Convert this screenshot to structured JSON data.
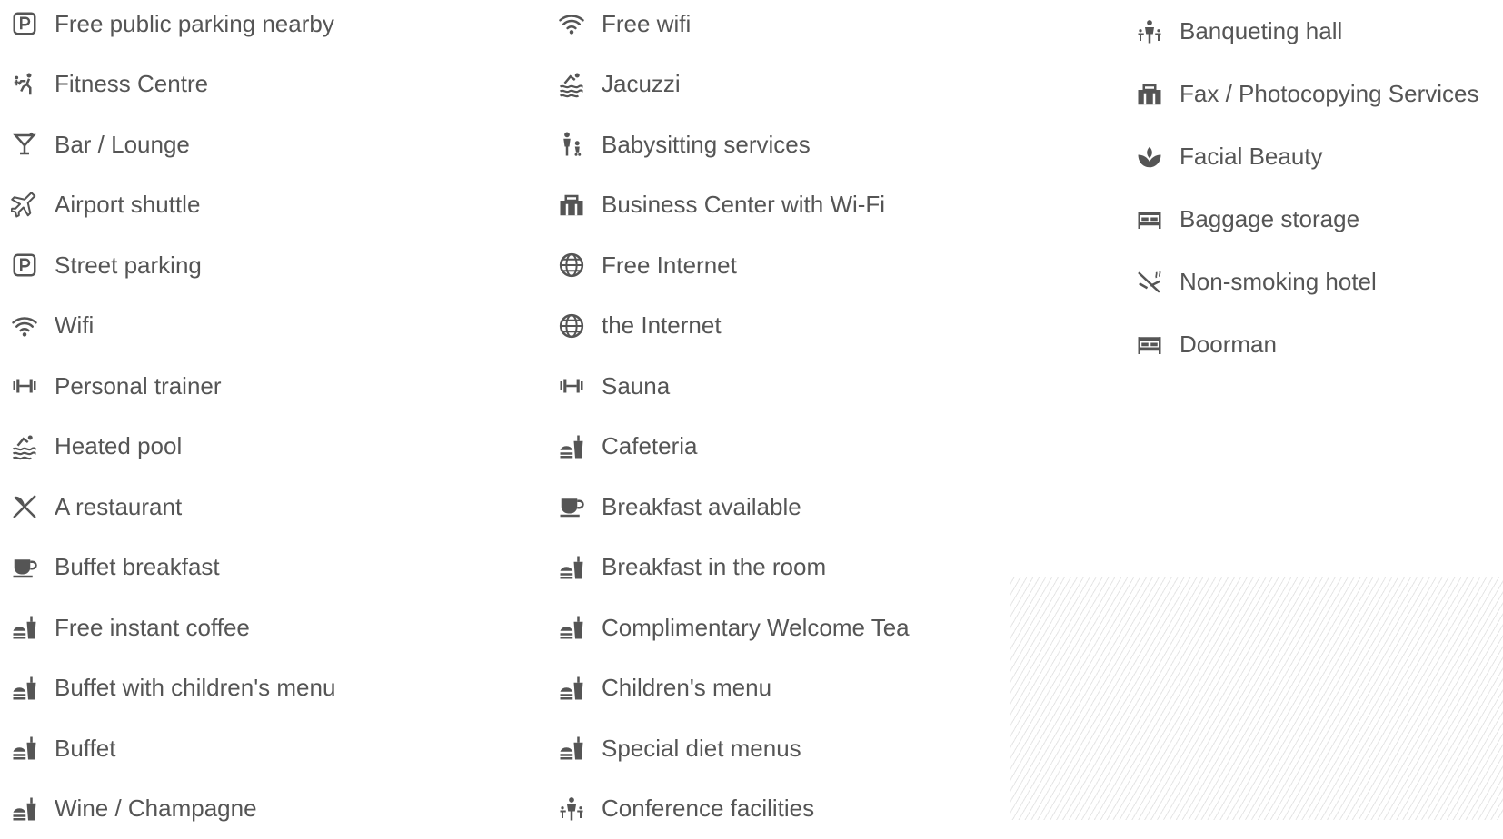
{
  "columns": [
    [
      {
        "label": "Free public parking nearby",
        "icon": "parking-icon"
      },
      {
        "label": "Fitness Centre",
        "icon": "fitness-icon"
      },
      {
        "label": "Bar / Lounge",
        "icon": "cocktail-icon"
      },
      {
        "label": "Airport shuttle",
        "icon": "airplane-icon"
      },
      {
        "label": "Street parking",
        "icon": "parking-icon"
      },
      {
        "label": "Wifi",
        "icon": "wifi-icon"
      },
      {
        "label": "Personal trainer",
        "icon": "dumbbell-icon"
      },
      {
        "label": "Heated pool",
        "icon": "pool-icon"
      },
      {
        "label": "A restaurant",
        "icon": "cutlery-icon"
      },
      {
        "label": "Buffet breakfast",
        "icon": "coffee-cup-icon"
      },
      {
        "label": "Free instant coffee",
        "icon": "food-drink-icon"
      },
      {
        "label": "Buffet with children's menu",
        "icon": "food-drink-icon"
      },
      {
        "label": "Buffet",
        "icon": "food-drink-icon"
      },
      {
        "label": "Wine / Champagne",
        "icon": "food-drink-icon"
      }
    ],
    [
      {
        "label": "Free wifi",
        "icon": "wifi-icon"
      },
      {
        "label": "Jacuzzi",
        "icon": "pool-icon"
      },
      {
        "label": "Babysitting services",
        "icon": "babysitting-icon"
      },
      {
        "label": "Business Center with Wi-Fi",
        "icon": "business-center-icon"
      },
      {
        "label": "Free Internet",
        "icon": "globe-icon"
      },
      {
        "label": "the Internet",
        "icon": "globe-icon"
      },
      {
        "label": "Sauna",
        "icon": "dumbbell-icon"
      },
      {
        "label": "Cafeteria",
        "icon": "food-drink-icon"
      },
      {
        "label": "Breakfast available",
        "icon": "coffee-cup-icon"
      },
      {
        "label": "Breakfast in the room",
        "icon": "food-drink-icon"
      },
      {
        "label": "Complimentary Welcome Tea",
        "icon": "food-drink-icon"
      },
      {
        "label": "Children's menu",
        "icon": "food-drink-icon"
      },
      {
        "label": "Special diet menus",
        "icon": "food-drink-icon"
      },
      {
        "label": "Conference facilities",
        "icon": "conference-icon"
      }
    ],
    [
      {
        "label": "Banqueting hall",
        "icon": "conference-icon"
      },
      {
        "label": "Fax / Photocopying Services",
        "icon": "business-center-icon"
      },
      {
        "label": "Facial Beauty",
        "icon": "lotus-icon"
      },
      {
        "label": "Baggage storage",
        "icon": "bed-icon"
      },
      {
        "label": "Non-smoking hotel",
        "icon": "no-smoking-icon"
      },
      {
        "label": "Doorman",
        "icon": "bed-icon"
      }
    ]
  ],
  "colors": {
    "text": "#555555",
    "icon": "#555555",
    "pattern": "#e6e6e6"
  }
}
